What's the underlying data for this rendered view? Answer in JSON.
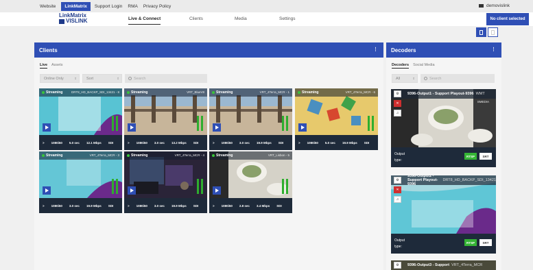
{
  "topbar": {
    "links": [
      "Website",
      "LinkMatrix",
      "Support Login",
      "RMA",
      "Privacy Policy"
    ],
    "active": "LinkMatrix",
    "user": "demovislink",
    "no_client": "No client selected"
  },
  "brand": {
    "line1": "LinkMatrix",
    "line2": "VISLINK"
  },
  "nav": [
    "Live & Connect",
    "Clients",
    "Media",
    "Settings"
  ],
  "clients": {
    "title": "Clients",
    "tabs": [
      "Live",
      "Assets"
    ],
    "filter_online": "Online Only",
    "filter_sort": "Sort",
    "search_placeholder": "Search",
    "cards": [
      {
        "status": "Streaming",
        "name": "DRT8_HD_BACKP_SDI_13421 - 8",
        "res": "1080i50",
        "latency": "5.0 sec",
        "rate": "12.1 Mbps",
        "iface": "SDI",
        "palette": "graphic"
      },
      {
        "status": "Streaming",
        "name": "VRT_BlueV8",
        "res": "1080i50",
        "latency": "3.0 sec",
        "rate": "13.2 Mbps",
        "iface": "SDI",
        "palette": "pier"
      },
      {
        "status": "Streaming",
        "name": "VRT_4Terra_MCR - 1",
        "res": "1080i50",
        "latency": "3.0 sec",
        "rate": "19.9 Mbps",
        "iface": "SDI",
        "palette": "pier"
      },
      {
        "status": "Streaming",
        "name": "VRT_4Terra_MCR - 6",
        "res": "1080i50",
        "latency": "5.0 sec",
        "rate": "19.9 Mbps",
        "iface": "SDI",
        "palette": "blocks"
      },
      {
        "status": "Streaming",
        "name": "VRT_4Terra_MCR - 3",
        "res": "1080i50",
        "latency": "3.0 sec",
        "rate": "19.9 Mbps",
        "iface": "SDI",
        "palette": "graphic2"
      },
      {
        "status": "Streaming",
        "name": "VRT_4Terra_MCR - 4",
        "res": "1080i50",
        "latency": "3.0 sec",
        "rate": "19.9 Mbps",
        "iface": "SDI",
        "palette": "studio"
      },
      {
        "status": "Streaming",
        "name": "VRT_Lisbon - 5",
        "res": "1080i50",
        "latency": "2.8 sec",
        "rate": "3.4 Mbps",
        "iface": "SDI",
        "palette": "food"
      }
    ]
  },
  "decoders": {
    "title": "Decoders",
    "tabs": [
      "Decoders",
      "Social Media"
    ],
    "filter_all": "All",
    "search_placeholder": "Search",
    "cards": [
      {
        "name": "9396-Output1 - Support Playout-9396",
        "rest": "WMT",
        "rest2": "SMEDIA",
        "output": "Output",
        "type": "type:",
        "rtsp": "RTSP",
        "srt": "SRT"
      },
      {
        "name": "9396-Output2 - Support Playout-9396",
        "rest": "DRT8_HD_BACKP_SDI_13421",
        "output": "Output",
        "type": "type:",
        "rtsp": "RTSP",
        "srt": "SRT"
      },
      {
        "name": "9396-Output3 - Support",
        "rest": "VRT_4Terra_MCR"
      }
    ]
  }
}
